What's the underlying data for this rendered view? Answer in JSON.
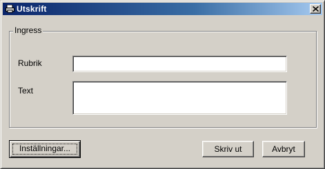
{
  "window": {
    "title": "Utskrift",
    "title_icon": "printer-app-icon",
    "close_icon": "close-icon",
    "colors": {
      "titlebar_start": "#0a246a",
      "titlebar_end": "#a6caf0",
      "face": "#d4d0c8"
    }
  },
  "group": {
    "legend": "Ingress",
    "rubrik_label": "Rubrik",
    "rubrik_value": "",
    "text_label": "Text",
    "text_value": ""
  },
  "buttons": {
    "settings": "Inställningar...",
    "print": "Skriv ut",
    "cancel": "Avbryt"
  }
}
